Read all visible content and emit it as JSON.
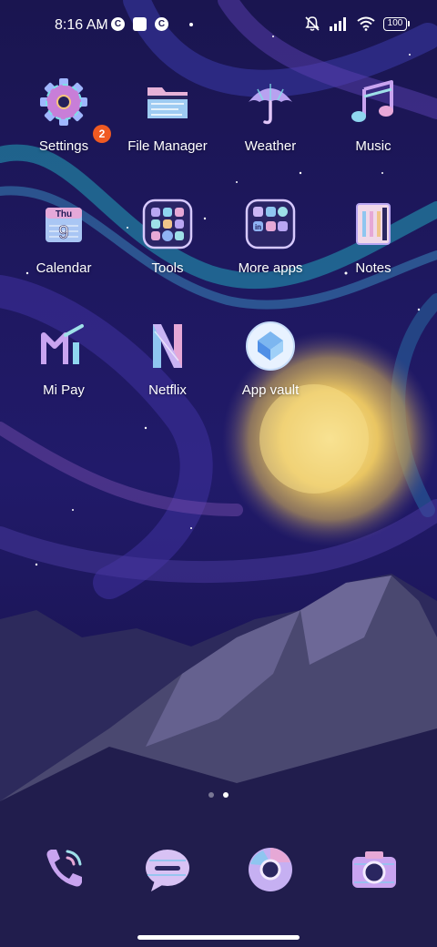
{
  "status_bar": {
    "time": "8:16 AM",
    "notification_icons": [
      "c-app-icon",
      "square-app-icon",
      "c-app-icon"
    ],
    "battery": "100",
    "system_icons": [
      "mute-icon",
      "signal-icon",
      "wifi-icon",
      "battery-icon"
    ]
  },
  "apps": {
    "settings": {
      "label": "Settings",
      "badge": "2"
    },
    "file_manager": {
      "label": "File Manager"
    },
    "weather": {
      "label": "Weather"
    },
    "music": {
      "label": "Music"
    },
    "calendar": {
      "label": "Calendar",
      "day": "9",
      "weekday": "Thu"
    },
    "tools": {
      "label": "Tools"
    },
    "more_apps": {
      "label": "More apps"
    },
    "notes": {
      "label": "Notes"
    },
    "mi_pay": {
      "label": "Mi Pay"
    },
    "netflix": {
      "label": "Netflix"
    },
    "app_vault": {
      "label": "App vault"
    }
  },
  "page_indicator": {
    "count": 2,
    "active": 2
  },
  "dock": [
    "phone-icon",
    "messaging-icon",
    "browser-icon",
    "camera-icon"
  ],
  "colors": {
    "badge": "#f05a22",
    "sky": "#1b1658",
    "moon": "#e8c560",
    "mountain": "#4a4870"
  }
}
